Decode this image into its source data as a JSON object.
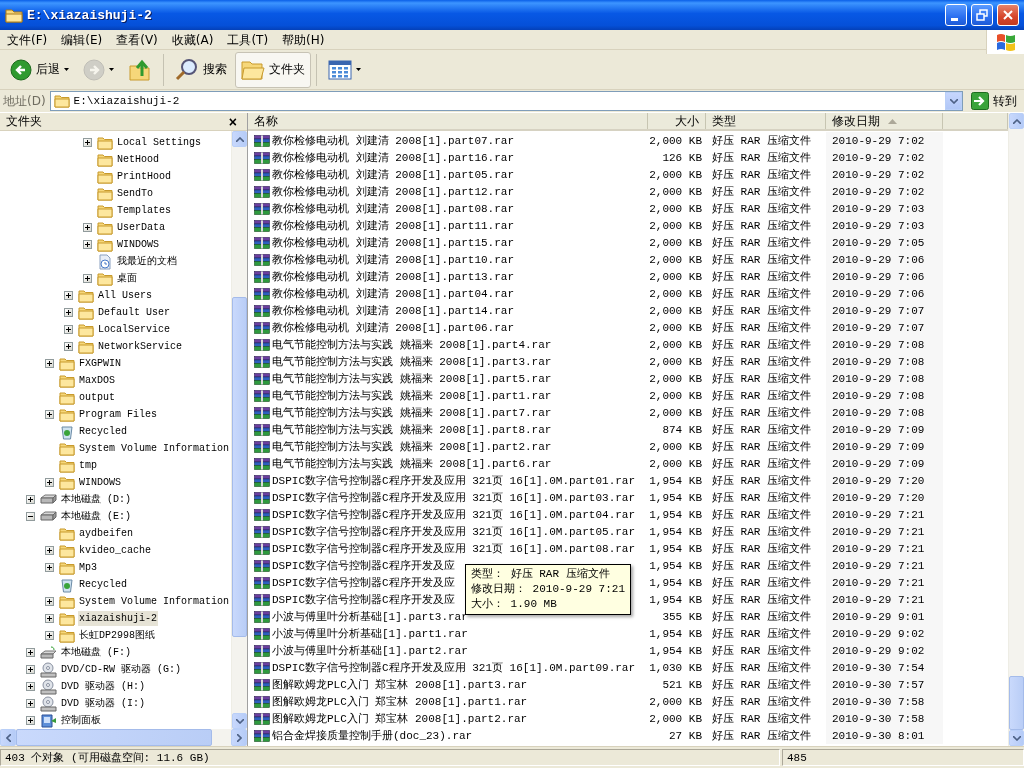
{
  "window": {
    "title": "E:\\xiazaishuji-2"
  },
  "menu": [
    "文件(F)",
    "编辑(E)",
    "查看(V)",
    "收藏(A)",
    "工具(T)",
    "帮助(H)"
  ],
  "toolbar": [
    {
      "kind": "back",
      "label": "后退",
      "disabled": false,
      "selected": false
    },
    {
      "kind": "forward",
      "disabled": true,
      "selected": false
    },
    {
      "kind": "up",
      "disabled": false,
      "selected": false
    },
    {
      "kind": "search",
      "label": "搜索",
      "disabled": false,
      "selected": false
    },
    {
      "kind": "folders",
      "label": "文件夹",
      "disabled": false,
      "selected": true
    },
    {
      "kind": "views",
      "disabled": false,
      "selected": false
    }
  ],
  "address": {
    "label": "地址(D)",
    "value": "E:\\xiazaishuji-2",
    "go": "转到"
  },
  "folders_pane": {
    "title": "文件夹",
    "close": "×",
    "tree": [
      {
        "children": [
          {
            "children": [
              {
                "children": [
                  {
                    "label": "Local Settings",
                    "kind": "folder",
                    "expanded": false,
                    "selected": false
                  },
                  {
                    "label": "NetHood",
                    "kind": "folder",
                    "selected": false
                  },
                  {
                    "label": "PrintHood",
                    "kind": "folder",
                    "selected": false
                  },
                  {
                    "label": "SendTo",
                    "kind": "folder",
                    "selected": false
                  },
                  {
                    "label": "Templates",
                    "kind": "folder",
                    "selected": false
                  },
                  {
                    "label": "UserData",
                    "kind": "folder",
                    "expanded": false,
                    "selected": false
                  },
                  {
                    "label": "WINDOWS",
                    "kind": "folder",
                    "expanded": false,
                    "selected": false
                  },
                  {
                    "label": "我最近的文档",
                    "kind": "recent",
                    "selected": false
                  },
                  {
                    "label": "桌面",
                    "kind": "folder",
                    "expanded": false,
                    "selected": false
                  }
                ]
              },
              {
                "label": "All Users",
                "kind": "folder",
                "expanded": false,
                "selected": false
              },
              {
                "label": "Default User",
                "kind": "folder",
                "expanded": false,
                "selected": false
              },
              {
                "label": "LocalService",
                "kind": "folder",
                "expanded": false,
                "selected": false
              },
              {
                "label": "NetworkService",
                "kind": "folder",
                "expanded": false,
                "selected": false
              }
            ]
          },
          {
            "label": "FXGPWIN",
            "kind": "folder",
            "expanded": false,
            "selected": false
          },
          {
            "label": "MaxDOS",
            "kind": "folder",
            "selected": false
          },
          {
            "label": "output",
            "kind": "folder",
            "selected": false
          },
          {
            "label": "Program Files",
            "kind": "folder",
            "expanded": false,
            "selected": false
          },
          {
            "label": "Recycled",
            "kind": "recycle",
            "selected": false
          },
          {
            "label": "System Volume Information",
            "kind": "folder",
            "selected": false
          },
          {
            "label": "tmp",
            "kind": "folder",
            "selected": false
          },
          {
            "label": "WINDOWS",
            "kind": "folder",
            "expanded": false,
            "selected": false
          }
        ]
      },
      {
        "label": "本地磁盘 (D:)",
        "kind": "drive",
        "expanded": false,
        "selected": false
      },
      {
        "label": "本地磁盘 (E:)",
        "kind": "drive",
        "expanded": true,
        "selected": false,
        "children": [
          {
            "label": "aydbeifen",
            "kind": "folder",
            "selected": false
          },
          {
            "label": "kvideo_cache",
            "kind": "folder",
            "expanded": false,
            "selected": false
          },
          {
            "label": "Mp3",
            "kind": "folder",
            "expanded": false,
            "selected": false
          },
          {
            "label": "Recycled",
            "kind": "recycle",
            "selected": false
          },
          {
            "label": "System Volume Information",
            "kind": "folder",
            "expanded": false,
            "selected": false
          },
          {
            "label": "xiazaishuji-2",
            "kind": "folder",
            "expanded": false,
            "selected": true
          },
          {
            "label": "长虹DP2998图纸",
            "kind": "folder",
            "expanded": false,
            "selected": false
          }
        ]
      },
      {
        "label": "本地磁盘 (F:)",
        "kind": "removable",
        "expanded": false,
        "selected": false
      },
      {
        "label": "DVD/CD-RW 驱动器 (G:)",
        "kind": "dvd",
        "expanded": false,
        "selected": false
      },
      {
        "label": "DVD 驱动器 (H:)",
        "kind": "dvd",
        "expanded": false,
        "selected": false
      },
      {
        "label": "DVD 驱动器 (I:)",
        "kind": "dvd",
        "expanded": false,
        "selected": false
      },
      {
        "label": "控制面板",
        "kind": "control",
        "expanded": false,
        "selected": false
      }
    ]
  },
  "file_list": {
    "columns": [
      {
        "label": "名称",
        "sorted": false
      },
      {
        "label": "大小",
        "sorted": false
      },
      {
        "label": "类型",
        "sorted": false
      },
      {
        "label": "修改日期",
        "sorted": true
      }
    ],
    "rows": [
      {
        "name": "教你检修电动机 刘建清 2008[1].part07.rar",
        "size": "2,000 KB",
        "type": "好压 RAR 压缩文件",
        "modified": "2010-9-29 7:02"
      },
      {
        "name": "教你检修电动机 刘建清 2008[1].part16.rar",
        "size": "126 KB",
        "type": "好压 RAR 压缩文件",
        "modified": "2010-9-29 7:02"
      },
      {
        "name": "教你检修电动机 刘建清 2008[1].part05.rar",
        "size": "2,000 KB",
        "type": "好压 RAR 压缩文件",
        "modified": "2010-9-29 7:02"
      },
      {
        "name": "教你检修电动机 刘建清 2008[1].part12.rar",
        "size": "2,000 KB",
        "type": "好压 RAR 压缩文件",
        "modified": "2010-9-29 7:02"
      },
      {
        "name": "教你检修电动机 刘建清 2008[1].part08.rar",
        "size": "2,000 KB",
        "type": "好压 RAR 压缩文件",
        "modified": "2010-9-29 7:03"
      },
      {
        "name": "教你检修电动机 刘建清 2008[1].part11.rar",
        "size": "2,000 KB",
        "type": "好压 RAR 压缩文件",
        "modified": "2010-9-29 7:03"
      },
      {
        "name": "教你检修电动机 刘建清 2008[1].part15.rar",
        "size": "2,000 KB",
        "type": "好压 RAR 压缩文件",
        "modified": "2010-9-29 7:05"
      },
      {
        "name": "教你检修电动机 刘建清 2008[1].part10.rar",
        "size": "2,000 KB",
        "type": "好压 RAR 压缩文件",
        "modified": "2010-9-29 7:06"
      },
      {
        "name": "教你检修电动机 刘建清 2008[1].part13.rar",
        "size": "2,000 KB",
        "type": "好压 RAR 压缩文件",
        "modified": "2010-9-29 7:06"
      },
      {
        "name": "教你检修电动机 刘建清 2008[1].part04.rar",
        "size": "2,000 KB",
        "type": "好压 RAR 压缩文件",
        "modified": "2010-9-29 7:06"
      },
      {
        "name": "教你检修电动机 刘建清 2008[1].part14.rar",
        "size": "2,000 KB",
        "type": "好压 RAR 压缩文件",
        "modified": "2010-9-29 7:07"
      },
      {
        "name": "教你检修电动机 刘建清 2008[1].part06.rar",
        "size": "2,000 KB",
        "type": "好压 RAR 压缩文件",
        "modified": "2010-9-29 7:07"
      },
      {
        "name": "电气节能控制方法与实践 姚福来 2008[1].part4.rar",
        "size": "2,000 KB",
        "type": "好压 RAR 压缩文件",
        "modified": "2010-9-29 7:08"
      },
      {
        "name": "电气节能控制方法与实践 姚福来 2008[1].part3.rar",
        "size": "2,000 KB",
        "type": "好压 RAR 压缩文件",
        "modified": "2010-9-29 7:08"
      },
      {
        "name": "电气节能控制方法与实践 姚福来 2008[1].part5.rar",
        "size": "2,000 KB",
        "type": "好压 RAR 压缩文件",
        "modified": "2010-9-29 7:08"
      },
      {
        "name": "电气节能控制方法与实践 姚福来 2008[1].part1.rar",
        "size": "2,000 KB",
        "type": "好压 RAR 压缩文件",
        "modified": "2010-9-29 7:08"
      },
      {
        "name": "电气节能控制方法与实践 姚福来 2008[1].part7.rar",
        "size": "2,000 KB",
        "type": "好压 RAR 压缩文件",
        "modified": "2010-9-29 7:08"
      },
      {
        "name": "电气节能控制方法与实践 姚福来 2008[1].part8.rar",
        "size": "874 KB",
        "type": "好压 RAR 压缩文件",
        "modified": "2010-9-29 7:09"
      },
      {
        "name": "电气节能控制方法与实践 姚福来 2008[1].part2.rar",
        "size": "2,000 KB",
        "type": "好压 RAR 压缩文件",
        "modified": "2010-9-29 7:09"
      },
      {
        "name": "电气节能控制方法与实践 姚福来 2008[1].part6.rar",
        "size": "2,000 KB",
        "type": "好压 RAR 压缩文件",
        "modified": "2010-9-29 7:09"
      },
      {
        "name": "DSPIC数字信号控制器C程序开发及应用 321页 16[1].0M.part01.rar",
        "size": "1,954 KB",
        "type": "好压 RAR 压缩文件",
        "modified": "2010-9-29 7:20"
      },
      {
        "name": "DSPIC数字信号控制器C程序开发及应用 321页 16[1].0M.part03.rar",
        "size": "1,954 KB",
        "type": "好压 RAR 压缩文件",
        "modified": "2010-9-29 7:20"
      },
      {
        "name": "DSPIC数字信号控制器C程序开发及应用 321页 16[1].0M.part04.rar",
        "size": "1,954 KB",
        "type": "好压 RAR 压缩文件",
        "modified": "2010-9-29 7:21"
      },
      {
        "name": "DSPIC数字信号控制器C程序开发及应用 321页 16[1].0M.part05.rar",
        "size": "1,954 KB",
        "type": "好压 RAR 压缩文件",
        "modified": "2010-9-29 7:21"
      },
      {
        "name": "DSPIC数字信号控制器C程序开发及应用 321页 16[1].0M.part08.rar",
        "size": "1,954 KB",
        "type": "好压 RAR 压缩文件",
        "modified": "2010-9-29 7:21"
      },
      {
        "name": "DSPIC数字信号控制器C程序开发及应",
        "size": "1,954 KB",
        "type": "好压 RAR 压缩文件",
        "modified": "2010-9-29 7:21"
      },
      {
        "name": "DSPIC数字信号控制器C程序开发及应",
        "size": "1,954 KB",
        "type": "好压 RAR 压缩文件",
        "modified": "2010-9-29 7:21"
      },
      {
        "name": "DSPIC数字信号控制器C程序开发及应",
        "size": "1,954 KB",
        "type": "好压 RAR 压缩文件",
        "modified": "2010-9-29 7:21"
      },
      {
        "name": "小波与傅里叶分析基础[1].part3.rar",
        "size": "355 KB",
        "type": "好压 RAR 压缩文件",
        "modified": "2010-9-29 9:01"
      },
      {
        "name": "小波与傅里叶分析基础[1].part1.rar",
        "size": "1,954 KB",
        "type": "好压 RAR 压缩文件",
        "modified": "2010-9-29 9:02"
      },
      {
        "name": "小波与傅里叶分析基础[1].part2.rar",
        "size": "1,954 KB",
        "type": "好压 RAR 压缩文件",
        "modified": "2010-9-29 9:02"
      },
      {
        "name": "DSPIC数字信号控制器C程序开发及应用 321页 16[1].0M.part09.rar",
        "size": "1,030 KB",
        "type": "好压 RAR 压缩文件",
        "modified": "2010-9-30 7:54"
      },
      {
        "name": "图解欧姆龙PLC入门 郑宝林 2008[1].part3.rar",
        "size": "521 KB",
        "type": "好压 RAR 压缩文件",
        "modified": "2010-9-30 7:57"
      },
      {
        "name": "图解欧姆龙PLC入门 郑宝林 2008[1].part1.rar",
        "size": "2,000 KB",
        "type": "好压 RAR 压缩文件",
        "modified": "2010-9-30 7:58"
      },
      {
        "name": "图解欧姆龙PLC入门 郑宝林 2008[1].part2.rar",
        "size": "2,000 KB",
        "type": "好压 RAR 压缩文件",
        "modified": "2010-9-30 7:58"
      },
      {
        "name": "铝合金焊接质量控制手册(doc_23).rar",
        "size": "27 KB",
        "type": "好压 RAR 压缩文件",
        "modified": "2010-9-30 8:01"
      }
    ],
    "tooltip": [
      "类型： 好压 RAR 压缩文件",
      "修改日期： 2010-9-29 7:21",
      "大小： 1.90 MB"
    ]
  },
  "status_bar": [
    "403 个对象 (可用磁盘空间: 11.6 GB)",
    "485"
  ]
}
